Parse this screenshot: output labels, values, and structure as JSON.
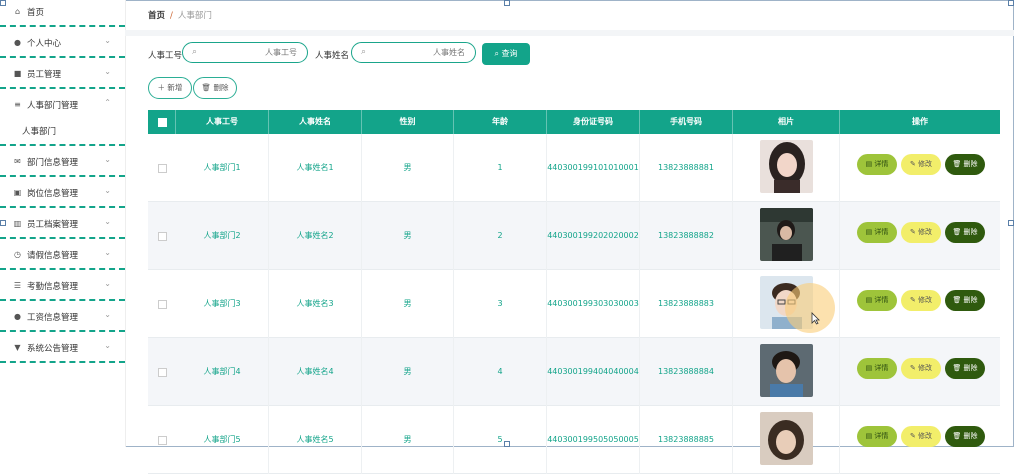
{
  "breadcrumb": {
    "home": "首页",
    "separator": "/",
    "current": "人事部门"
  },
  "sidebar": {
    "items": [
      {
        "label": "首页",
        "icon": "home-icon",
        "glyph": "⌂",
        "chevron": ""
      },
      {
        "label": "个人中心",
        "icon": "user-icon",
        "glyph": "●",
        "chevron": "⌄"
      },
      {
        "label": "员工管理",
        "icon": "briefcase-icon",
        "glyph": "■",
        "chevron": "⌄"
      },
      {
        "label": "人事部门管理",
        "icon": "list-icon",
        "glyph": "≡",
        "chevron": "⌃"
      },
      {
        "label": "部门信息管理",
        "icon": "mail-icon",
        "glyph": "✉",
        "chevron": "⌄"
      },
      {
        "label": "岗位信息管理",
        "icon": "seat-icon",
        "glyph": "▣",
        "chevron": "⌄"
      },
      {
        "label": "员工档案管理",
        "icon": "chart-icon",
        "glyph": "▥",
        "chevron": "⌄"
      },
      {
        "label": "请假信息管理",
        "icon": "clock-icon",
        "glyph": "◷",
        "chevron": "⌄"
      },
      {
        "label": "考勤信息管理",
        "icon": "sliders-icon",
        "glyph": "☰",
        "chevron": "⌄"
      },
      {
        "label": "工资信息管理",
        "icon": "person-icon",
        "glyph": "●",
        "chevron": "⌄"
      },
      {
        "label": "系统公告管理",
        "icon": "notice-icon",
        "glyph": "▼",
        "chevron": "⌄"
      }
    ],
    "submenu_label": "人事部门"
  },
  "search": {
    "id_label": "人事工号",
    "id_placeholder": "人事工号",
    "name_label": "人事姓名",
    "name_placeholder": "人事姓名",
    "button": "查询",
    "search_glyph": "⌕"
  },
  "actions": {
    "add": "＋ 新增",
    "delete": "🗑 删除"
  },
  "table": {
    "headers": [
      "人事工号",
      "人事姓名",
      "性别",
      "年龄",
      "身份证号码",
      "手机号码",
      "相片",
      "操作"
    ],
    "rows": [
      {
        "id": "人事部门1",
        "name": "人事姓名1",
        "gender": "男",
        "age": "1",
        "idcard": "440300199101010001",
        "phone": "13823888881"
      },
      {
        "id": "人事部门2",
        "name": "人事姓名2",
        "gender": "男",
        "age": "2",
        "idcard": "440300199202020002",
        "phone": "13823888882"
      },
      {
        "id": "人事部门3",
        "name": "人事姓名3",
        "gender": "男",
        "age": "3",
        "idcard": "440300199303030003",
        "phone": "13823888883"
      },
      {
        "id": "人事部门4",
        "name": "人事姓名4",
        "gender": "男",
        "age": "4",
        "idcard": "440300199404040004",
        "phone": "13823888884"
      },
      {
        "id": "人事部门5",
        "name": "人事姓名5",
        "gender": "男",
        "age": "5",
        "idcard": "440300199505050005",
        "phone": "13823888885"
      }
    ],
    "row_actions": {
      "detail": "▤ 详情",
      "edit": "✎ 修改",
      "delete": "🗑 删除"
    }
  },
  "colors": {
    "accent": "#13a48a",
    "detail": "#9ec43a",
    "edit": "#f2ee6a",
    "delete": "#2f5a0e"
  }
}
